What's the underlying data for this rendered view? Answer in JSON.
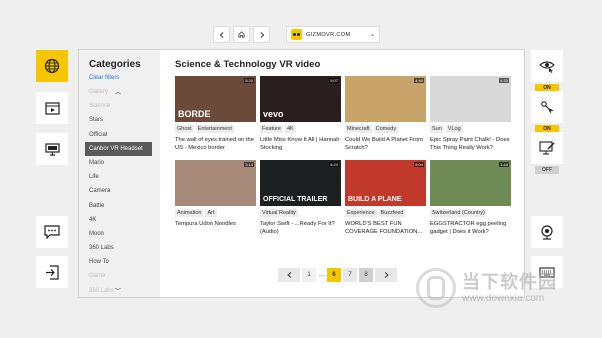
{
  "topbar": {
    "back_icon": "chevron-left",
    "home_icon": "home",
    "forward_icon": "chevron-right",
    "site": "GIZMOVR.COM",
    "dropdown_icon": "chevron-down"
  },
  "left_tiles": [
    {
      "icon": "globe-icon",
      "accent": "#f6c600"
    },
    {
      "icon": "video-player-icon"
    },
    {
      "icon": "monitor-icon"
    },
    {
      "icon": "chat-icon"
    },
    {
      "icon": "exit-icon"
    }
  ],
  "right_tiles": [
    {
      "icon": "eye-cursor-icon",
      "state": "ON"
    },
    {
      "icon": "pointer-icon",
      "state": "ON"
    },
    {
      "icon": "screen-edit-icon",
      "state": "OFF"
    },
    {
      "icon": "webcam-icon"
    },
    {
      "icon": "keyboard-icon"
    }
  ],
  "sidebar": {
    "title": "Categories",
    "clear": "Clear filters",
    "items": [
      {
        "label": "Gallery",
        "faded": true
      },
      {
        "label": "Science",
        "faded": true
      },
      {
        "label": "Stars"
      },
      {
        "label": "Official"
      },
      {
        "label": "Canbor VR Headset",
        "active": true
      },
      {
        "label": "Mario"
      },
      {
        "label": "Life"
      },
      {
        "label": "Camera"
      },
      {
        "label": "Battle"
      },
      {
        "label": "4K"
      },
      {
        "label": "Moon"
      },
      {
        "label": "360 Labs"
      },
      {
        "label": "How To"
      },
      {
        "label": "Game",
        "faded": true
      },
      {
        "label": "360 Labs",
        "faded": true
      }
    ]
  },
  "main": {
    "heading": "Science & Technology VR video",
    "videos": [
      {
        "tags": [
          "Ghost",
          "Entertainment"
        ],
        "title": "The wall of eyes trained on the US - Mexico border",
        "duration": "5:20",
        "overlay": "BORDE",
        "bg": "#6b4a3a"
      },
      {
        "tags": [
          "Feature",
          "4K"
        ],
        "title": "Little Miss Know It All | Hannah Stocking",
        "duration": "5:07",
        "overlay": "vevo",
        "bg": "#2a1e1e"
      },
      {
        "tags": [
          "Minecraft",
          "Comedy"
        ],
        "title": "Could We Build A Planet From Scratch?",
        "duration": "4:40",
        "overlay": "",
        "bg": "#c9a46a"
      },
      {
        "tags": [
          "Sun",
          "VLog"
        ],
        "title": "Epic Spray Paint Chalk! - Does This Thing Really Work?",
        "duration": "4:33",
        "overlay": "",
        "bg": "#d8d8d8"
      },
      {
        "tags": [
          "Animation",
          "Art"
        ],
        "title": "Tempura Udon Noodles",
        "duration": "3:14",
        "overlay": "",
        "bg": "#a88a7a"
      },
      {
        "tags": [
          "Virtual Reality"
        ],
        "title": "Taylor Swift - ...Ready For It? (Audio)",
        "duration": "4:24",
        "overlay": "OFFICIAL TRAILER",
        "bg": "#1c2020"
      },
      {
        "tags": [
          "Experience",
          "Buzzfeed"
        ],
        "title": "WORLD'S BEST FUN COVERAGE FOUNDATION...",
        "duration": "8:04",
        "overlay": "BUILD A PLANE",
        "bg": "#c0392b"
      },
      {
        "tags": [
          "Switzerland (Country)"
        ],
        "title": "EGGSTRACTOR egg peeling gadget | Does it Work?",
        "duration": "1:44",
        "overlay": "",
        "bg": "#6f8a55"
      }
    ]
  },
  "pagination": {
    "prev_icon": "chevron-left",
    "next_icon": "chevron-right",
    "pages": [
      "1",
      "...",
      "6",
      "7",
      "8"
    ],
    "current": "6"
  },
  "watermark": {
    "text": "当下软件园",
    "url": "www.downxia.com"
  }
}
